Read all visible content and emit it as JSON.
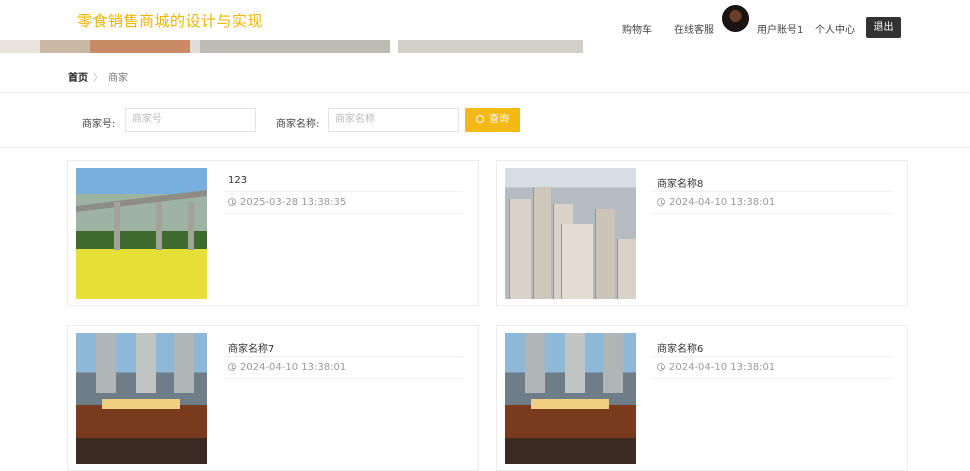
{
  "header": {
    "site_title": "零食销售商城的设计与实现",
    "nav": {
      "cart": "购物车",
      "service": "在线客服",
      "account": "用户账号1",
      "profile": "个人中心",
      "logout": "退出"
    }
  },
  "breadcrumb": {
    "home": "首页",
    "separator": "〉",
    "current": "商家"
  },
  "search": {
    "merchant_no_label": "商家号:",
    "merchant_no_placeholder": "商家号",
    "merchant_name_label": "商家名称:",
    "merchant_name_placeholder": "商家名称",
    "button_label": "查询"
  },
  "merchants": [
    {
      "name": "123",
      "time": "2025-03-28 13:38:35",
      "image": "field"
    },
    {
      "name": "商家名称8",
      "time": "2024-04-10 13:38:01",
      "image": "city"
    },
    {
      "name": "商家名称7",
      "time": "2024-04-10 13:38:01",
      "image": "shop"
    },
    {
      "name": "商家名称6",
      "time": "2024-04-10 13:38:01",
      "image": "shop"
    }
  ],
  "colors": {
    "accent": "#f5b915",
    "title": "#f0b400",
    "dark_button": "#333333"
  }
}
